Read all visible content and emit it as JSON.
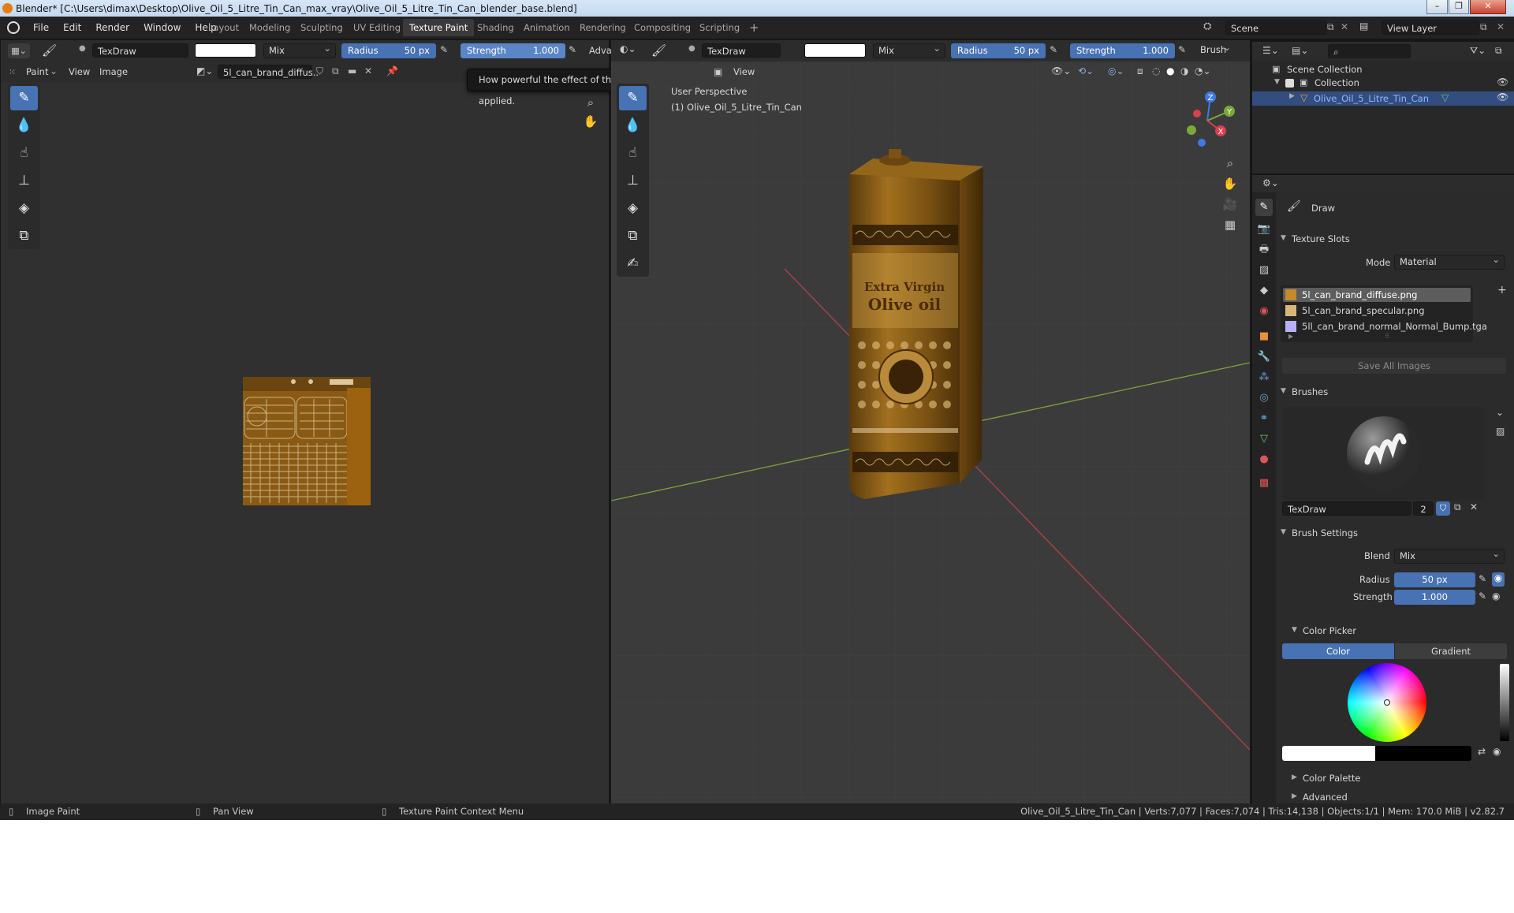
{
  "window": {
    "title": "Blender* [C:\\Users\\dimax\\Desktop\\Olive_Oil_5_Litre_Tin_Can_max_vray\\Olive_Oil_5_Litre_Tin_Can_blender_base.blend]",
    "min_label": "–",
    "max_label": "❐",
    "close_label": "✕"
  },
  "menu": [
    "File",
    "Edit",
    "Render",
    "Window",
    "Help"
  ],
  "workspaces": [
    {
      "label": "Layout",
      "active": false
    },
    {
      "label": "Modeling",
      "active": false
    },
    {
      "label": "Sculpting",
      "active": false
    },
    {
      "label": "UV Editing",
      "active": false
    },
    {
      "label": "Texture Paint",
      "active": true
    },
    {
      "label": "Shading",
      "active": false
    },
    {
      "label": "Animation",
      "active": false
    },
    {
      "label": "Rendering",
      "active": false
    },
    {
      "label": "Compositing",
      "active": false
    },
    {
      "label": "Scripting",
      "active": false
    }
  ],
  "add_workspace": "+",
  "scene": {
    "label": "Scene",
    "view_layer": "View Layer"
  },
  "image_editor": {
    "brush_name": "TexDraw",
    "blend": "Mix",
    "radius_label": "Radius",
    "radius_value": "50 px",
    "strength_label": "Strength",
    "strength_value": "1.000",
    "adv_label": "Adva",
    "mode": "Paint",
    "view_menu": "View",
    "image_menu": "Image",
    "image_name": "5l_can_brand_diffus.."
  },
  "viewport": {
    "brush_name": "TexDraw",
    "blend": "Mix",
    "radius_label": "Radius",
    "radius_value": "50 px",
    "strength_label": "Strength",
    "strength_value": "1.000",
    "brush_menu": "Brush",
    "view_menu": "View",
    "perspective": "User Perspective",
    "object_line": "(1) Olive_Oil_5_Litre_Tin_Can",
    "label_line1": "Extra Virgin",
    "label_line2": "Olive oil",
    "gizmo": {
      "z": "Z",
      "y": "Y",
      "x": "X"
    }
  },
  "tooltip": "How powerful the effect of the brush is when applied.",
  "outliner": {
    "scene_collection": "Scene Collection",
    "collection": "Collection",
    "object": "Olive_Oil_5_Litre_Tin_Can"
  },
  "properties": {
    "tool_name": "Draw",
    "texture_slots_title": "Texture Slots",
    "mode_label": "Mode",
    "mode_value": "Material",
    "slots": [
      {
        "name": "5l_can_brand_diffuse.png",
        "color": "#c48a2c",
        "selected": true
      },
      {
        "name": "5l_can_brand_specular.png",
        "color": "#d8b878",
        "selected": false
      },
      {
        "name": "5ll_can_brand_normal_Normal_Bump.tga",
        "color": "#b7b2f5",
        "selected": false
      }
    ],
    "save_all": "Save All Images",
    "brushes_title": "Brushes",
    "brush_name": "TexDraw",
    "brush_users": "2",
    "brush_settings_title": "Brush Settings",
    "blend_label": "Blend",
    "blend_value": "Mix",
    "radius_label": "Radius",
    "radius_value": "50 px",
    "strength_label": "Strength",
    "strength_value": "1.000",
    "color_picker_title": "Color Picker",
    "color_tab": "Color",
    "gradient_tab": "Gradient",
    "color_palette": "Color Palette",
    "advanced": "Advanced"
  },
  "status": {
    "left1": "Image Paint",
    "left2": "Pan View",
    "left3": "Texture Paint Context Menu",
    "right": "Olive_Oil_5_Litre_Tin_Can | Verts:7,077 | Faces:7,074 | Tris:14,138 | Objects:1/1 | Mem: 170.0 MiB | v2.82.7"
  },
  "colors": {
    "accent": "#4772b3",
    "selected_row": "#334d80",
    "can_base": "#8a5a14"
  }
}
